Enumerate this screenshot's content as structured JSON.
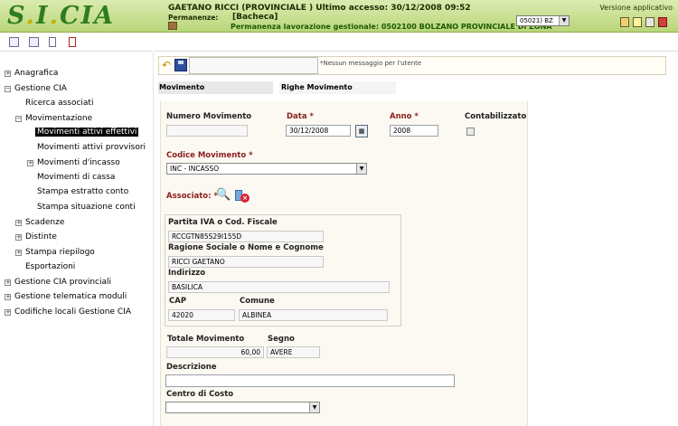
{
  "header": {
    "logo_text": "S.I.CIA",
    "user_line": "GAETANO RICCI (PROVINCIALE ) Ultimo accesso: 30/12/2008 09:52",
    "perm_label": "Permanenze:",
    "perm_value": "[Bacheca]",
    "perm_lavorazione": "Permanenza lavorazione gestionale: 0502100 BOLZANO PROVINCIALE DI ZONA",
    "versione": "Versione applicativo",
    "office_select": "05021) BZ"
  },
  "action_bar": {
    "message": "*Nessun messaggio per l'utente"
  },
  "sidebar": {
    "items": [
      {
        "label": "Anagrafica"
      },
      {
        "label": "Gestione CIA"
      },
      {
        "label": "Ricerca associati"
      },
      {
        "label": "Movimentazione"
      },
      {
        "label": "Movimenti attivi effettivi"
      },
      {
        "label": "Movimenti attivi provvisori"
      },
      {
        "label": "Movimenti d'incasso"
      },
      {
        "label": "Movimenti di cassa"
      },
      {
        "label": "Stampa estratto conto"
      },
      {
        "label": "Stampa situazione conti"
      },
      {
        "label": "Scadenze"
      },
      {
        "label": "Distinte"
      },
      {
        "label": "Stampa riepilogo"
      },
      {
        "label": "Esportazioni"
      },
      {
        "label": "Gestione CIA provinciali"
      },
      {
        "label": "Gestione telematica moduli"
      },
      {
        "label": "Codifiche locali Gestione CIA"
      }
    ]
  },
  "tabs": {
    "movimento": "Movimento",
    "righe": "Righe Movimento"
  },
  "form": {
    "numero_label": "Numero Movimento",
    "numero_value": "",
    "data_label": "Data *",
    "data_value": "30/12/2008",
    "anno_label": "Anno *",
    "anno_value": "2008",
    "contab_label": "Contabilizzato",
    "codice_label": "Codice Movimento *",
    "codice_value": "INC - INCASSO",
    "associato_label": "Associato: *",
    "piva_label": "Partita IVA o Cod. Fiscale",
    "piva_value": "RCCGTN85S29I155D",
    "ragione_label": "Ragione Sociale o Nome e Cognome",
    "ragione_value": "RICCI GAETANO",
    "indirizzo_label": "Indirizzo",
    "indirizzo_value": "BASILICA",
    "cap_label": "CAP",
    "cap_value": "42020",
    "comune_label": "Comune",
    "comune_value": "ALBINEA",
    "totale_label": "Totale Movimento",
    "totale_value": "60,00",
    "segno_label": "Segno",
    "segno_value": "AVERE",
    "descrizione_label": "Descrizione",
    "descrizione_value": "",
    "centro_label": "Centro di Costo",
    "centro_value": ""
  },
  "icons": {
    "undo": "undo-arrow-icon",
    "save": "floppy-disk-icon",
    "calendar": "calendar-icon",
    "search": "search-associate-icon",
    "remove": "remove-associate-icon"
  },
  "colors": {
    "header_green": "#b9d67a",
    "logo_green": "#2f7d1f",
    "required_label": "#8b1e1e",
    "selected_item_bg": "#000000"
  }
}
